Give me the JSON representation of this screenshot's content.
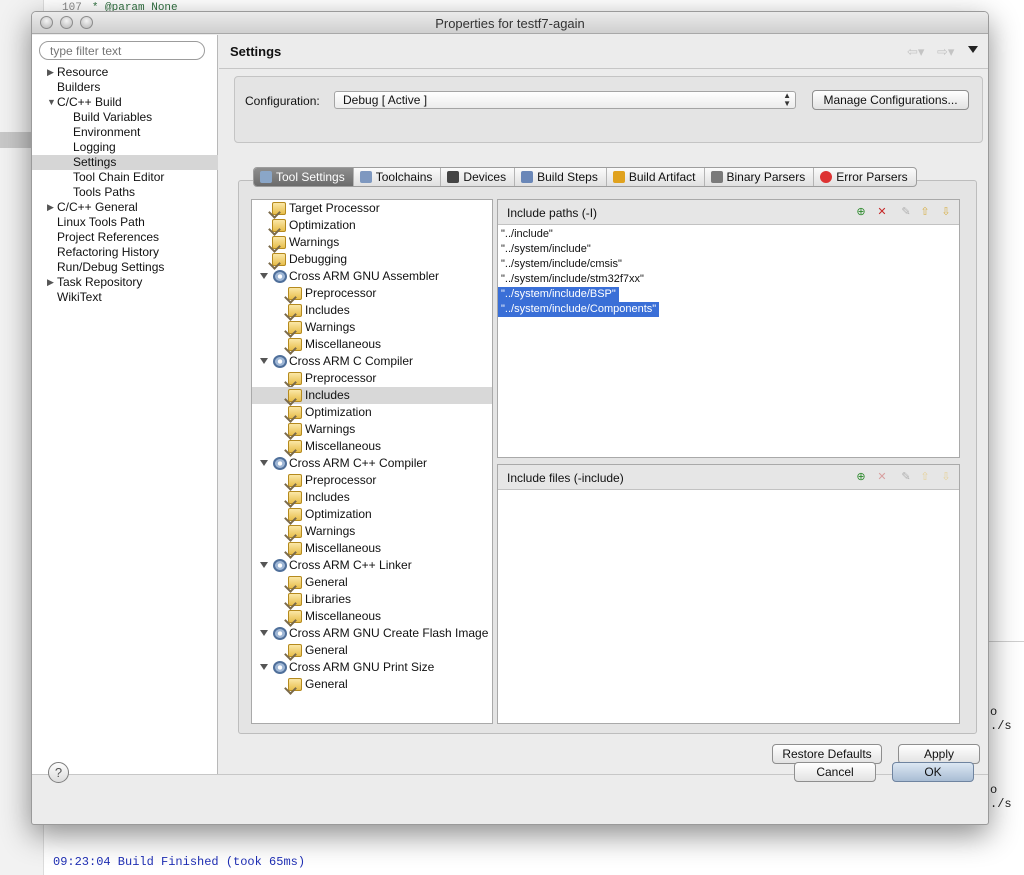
{
  "background": {
    "code_line_number": "107",
    "code_text": "* @param  None",
    "console_status": "09:23:04 Build Finished (took 65ms)",
    "side_fragments": [
      "o ./s",
      "o ./s"
    ]
  },
  "dialog": {
    "title": "Properties for testf7-again"
  },
  "sidebar": {
    "filter_placeholder": "type filter text",
    "items": [
      {
        "label": "Resource",
        "level": 0,
        "expander": "collapsed"
      },
      {
        "label": "Builders",
        "level": 0,
        "expander": "none"
      },
      {
        "label": "C/C++ Build",
        "level": 0,
        "expander": "expanded"
      },
      {
        "label": "Build Variables",
        "level": 1,
        "expander": "none"
      },
      {
        "label": "Environment",
        "level": 1,
        "expander": "none"
      },
      {
        "label": "Logging",
        "level": 1,
        "expander": "none"
      },
      {
        "label": "Settings",
        "level": 1,
        "expander": "none",
        "selected": true
      },
      {
        "label": "Tool Chain Editor",
        "level": 1,
        "expander": "none"
      },
      {
        "label": "Tools Paths",
        "level": 1,
        "expander": "none"
      },
      {
        "label": "C/C++ General",
        "level": 0,
        "expander": "collapsed"
      },
      {
        "label": "Linux Tools Path",
        "level": 0,
        "expander": "none"
      },
      {
        "label": "Project References",
        "level": 0,
        "expander": "none"
      },
      {
        "label": "Refactoring History",
        "level": 0,
        "expander": "none"
      },
      {
        "label": "Run/Debug Settings",
        "level": 0,
        "expander": "none"
      },
      {
        "label": "Task Repository",
        "level": 0,
        "expander": "collapsed"
      },
      {
        "label": "WikiText",
        "level": 0,
        "expander": "none"
      }
    ]
  },
  "header": {
    "title": "Settings",
    "back_icon": "back-arrow-icon",
    "forward_icon": "forward-arrow-icon",
    "menu_icon": "view-menu-icon"
  },
  "configuration": {
    "label": "Configuration:",
    "value": "Debug  [ Active ]",
    "manage_button": "Manage Configurations..."
  },
  "tabs": [
    {
      "label": "Tool Settings",
      "icon": "tool-settings-icon",
      "active": true
    },
    {
      "label": "Toolchains",
      "icon": "toolchains-icon"
    },
    {
      "label": "Devices",
      "icon": "devices-icon"
    },
    {
      "label": "Build Steps",
      "icon": "build-steps-icon"
    },
    {
      "label": "Build Artifact",
      "icon": "build-artifact-icon"
    },
    {
      "label": "Binary Parsers",
      "icon": "binary-parsers-icon"
    },
    {
      "label": "Error Parsers",
      "icon": "error-parsers-icon"
    }
  ],
  "tool_tree": [
    {
      "label": "Target Processor",
      "level": 0,
      "type": "option"
    },
    {
      "label": "Optimization",
      "level": 0,
      "type": "option"
    },
    {
      "label": "Warnings",
      "level": 0,
      "type": "option"
    },
    {
      "label": "Debugging",
      "level": 0,
      "type": "option"
    },
    {
      "label": "Cross ARM GNU Assembler",
      "level": 0,
      "type": "tool"
    },
    {
      "label": "Preprocessor",
      "level": 1,
      "type": "option"
    },
    {
      "label": "Includes",
      "level": 1,
      "type": "option"
    },
    {
      "label": "Warnings",
      "level": 1,
      "type": "option"
    },
    {
      "label": "Miscellaneous",
      "level": 1,
      "type": "option"
    },
    {
      "label": "Cross ARM C Compiler",
      "level": 0,
      "type": "tool"
    },
    {
      "label": "Preprocessor",
      "level": 1,
      "type": "option"
    },
    {
      "label": "Includes",
      "level": 1,
      "type": "option",
      "selected": true
    },
    {
      "label": "Optimization",
      "level": 1,
      "type": "option"
    },
    {
      "label": "Warnings",
      "level": 1,
      "type": "option"
    },
    {
      "label": "Miscellaneous",
      "level": 1,
      "type": "option"
    },
    {
      "label": "Cross ARM C++ Compiler",
      "level": 0,
      "type": "tool"
    },
    {
      "label": "Preprocessor",
      "level": 1,
      "type": "option"
    },
    {
      "label": "Includes",
      "level": 1,
      "type": "option"
    },
    {
      "label": "Optimization",
      "level": 1,
      "type": "option"
    },
    {
      "label": "Warnings",
      "level": 1,
      "type": "option"
    },
    {
      "label": "Miscellaneous",
      "level": 1,
      "type": "option"
    },
    {
      "label": "Cross ARM C++ Linker",
      "level": 0,
      "type": "tool"
    },
    {
      "label": "General",
      "level": 1,
      "type": "option"
    },
    {
      "label": "Libraries",
      "level": 1,
      "type": "option"
    },
    {
      "label": "Miscellaneous",
      "level": 1,
      "type": "option"
    },
    {
      "label": "Cross ARM GNU Create Flash Image",
      "level": 0,
      "type": "tool"
    },
    {
      "label": "General",
      "level": 1,
      "type": "option"
    },
    {
      "label": "Cross ARM GNU Print Size",
      "level": 0,
      "type": "tool"
    },
    {
      "label": "General",
      "level": 1,
      "type": "option"
    }
  ],
  "include_paths": {
    "title": "Include paths (-I)",
    "items": [
      {
        "text": "\"../include\"",
        "selected": false
      },
      {
        "text": "\"../system/include\"",
        "selected": false
      },
      {
        "text": "\"../system/include/cmsis\"",
        "selected": false
      },
      {
        "text": "\"../system/include/stm32f7xx\"",
        "selected": false
      },
      {
        "text": "\"../system/include/BSP\"",
        "selected": true
      },
      {
        "text": "\"../system/include/Components\"",
        "selected": true
      }
    ]
  },
  "include_files": {
    "title": "Include files (-include)",
    "items": []
  },
  "toolbar_icons": [
    "add-icon",
    "delete-icon",
    "edit-icon",
    "move-up-icon",
    "move-down-icon"
  ],
  "buttons": {
    "restore_defaults": "Restore Defaults",
    "apply": "Apply",
    "cancel": "Cancel",
    "ok": "OK",
    "help": "?"
  },
  "colors": {
    "selection_blue": "#3a6fd7",
    "console_blue": "#1f2fb5",
    "active_tab": "#7d7d7d"
  }
}
